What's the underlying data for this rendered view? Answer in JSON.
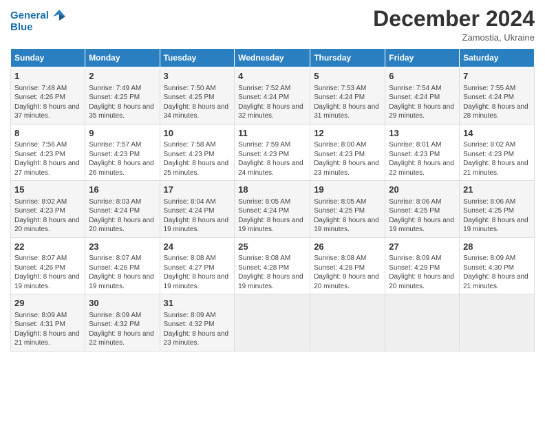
{
  "header": {
    "logo_line1": "General",
    "logo_line2": "Blue",
    "month_title": "December 2024",
    "location": "Zamostia, Ukraine"
  },
  "weekdays": [
    "Sunday",
    "Monday",
    "Tuesday",
    "Wednesday",
    "Thursday",
    "Friday",
    "Saturday"
  ],
  "weeks": [
    [
      {
        "day": "1",
        "info": "Sunrise: 7:48 AM\nSunset: 4:26 PM\nDaylight: 8 hours and 37 minutes."
      },
      {
        "day": "2",
        "info": "Sunrise: 7:49 AM\nSunset: 4:25 PM\nDaylight: 8 hours and 35 minutes."
      },
      {
        "day": "3",
        "info": "Sunrise: 7:50 AM\nSunset: 4:25 PM\nDaylight: 8 hours and 34 minutes."
      },
      {
        "day": "4",
        "info": "Sunrise: 7:52 AM\nSunset: 4:24 PM\nDaylight: 8 hours and 32 minutes."
      },
      {
        "day": "5",
        "info": "Sunrise: 7:53 AM\nSunset: 4:24 PM\nDaylight: 8 hours and 31 minutes."
      },
      {
        "day": "6",
        "info": "Sunrise: 7:54 AM\nSunset: 4:24 PM\nDaylight: 8 hours and 29 minutes."
      },
      {
        "day": "7",
        "info": "Sunrise: 7:55 AM\nSunset: 4:24 PM\nDaylight: 8 hours and 28 minutes."
      }
    ],
    [
      {
        "day": "8",
        "info": "Sunrise: 7:56 AM\nSunset: 4:23 PM\nDaylight: 8 hours and 27 minutes."
      },
      {
        "day": "9",
        "info": "Sunrise: 7:57 AM\nSunset: 4:23 PM\nDaylight: 8 hours and 26 minutes."
      },
      {
        "day": "10",
        "info": "Sunrise: 7:58 AM\nSunset: 4:23 PM\nDaylight: 8 hours and 25 minutes."
      },
      {
        "day": "11",
        "info": "Sunrise: 7:59 AM\nSunset: 4:23 PM\nDaylight: 8 hours and 24 minutes."
      },
      {
        "day": "12",
        "info": "Sunrise: 8:00 AM\nSunset: 4:23 PM\nDaylight: 8 hours and 23 minutes."
      },
      {
        "day": "13",
        "info": "Sunrise: 8:01 AM\nSunset: 4:23 PM\nDaylight: 8 hours and 22 minutes."
      },
      {
        "day": "14",
        "info": "Sunrise: 8:02 AM\nSunset: 4:23 PM\nDaylight: 8 hours and 21 minutes."
      }
    ],
    [
      {
        "day": "15",
        "info": "Sunrise: 8:02 AM\nSunset: 4:23 PM\nDaylight: 8 hours and 20 minutes."
      },
      {
        "day": "16",
        "info": "Sunrise: 8:03 AM\nSunset: 4:24 PM\nDaylight: 8 hours and 20 minutes."
      },
      {
        "day": "17",
        "info": "Sunrise: 8:04 AM\nSunset: 4:24 PM\nDaylight: 8 hours and 19 minutes."
      },
      {
        "day": "18",
        "info": "Sunrise: 8:05 AM\nSunset: 4:24 PM\nDaylight: 8 hours and 19 minutes."
      },
      {
        "day": "19",
        "info": "Sunrise: 8:05 AM\nSunset: 4:25 PM\nDaylight: 8 hours and 19 minutes."
      },
      {
        "day": "20",
        "info": "Sunrise: 8:06 AM\nSunset: 4:25 PM\nDaylight: 8 hours and 19 minutes."
      },
      {
        "day": "21",
        "info": "Sunrise: 8:06 AM\nSunset: 4:25 PM\nDaylight: 8 hours and 19 minutes."
      }
    ],
    [
      {
        "day": "22",
        "info": "Sunrise: 8:07 AM\nSunset: 4:26 PM\nDaylight: 8 hours and 19 minutes."
      },
      {
        "day": "23",
        "info": "Sunrise: 8:07 AM\nSunset: 4:26 PM\nDaylight: 8 hours and 19 minutes."
      },
      {
        "day": "24",
        "info": "Sunrise: 8:08 AM\nSunset: 4:27 PM\nDaylight: 8 hours and 19 minutes."
      },
      {
        "day": "25",
        "info": "Sunrise: 8:08 AM\nSunset: 4:28 PM\nDaylight: 8 hours and 19 minutes."
      },
      {
        "day": "26",
        "info": "Sunrise: 8:08 AM\nSunset: 4:28 PM\nDaylight: 8 hours and 20 minutes."
      },
      {
        "day": "27",
        "info": "Sunrise: 8:09 AM\nSunset: 4:29 PM\nDaylight: 8 hours and 20 minutes."
      },
      {
        "day": "28",
        "info": "Sunrise: 8:09 AM\nSunset: 4:30 PM\nDaylight: 8 hours and 21 minutes."
      }
    ],
    [
      {
        "day": "29",
        "info": "Sunrise: 8:09 AM\nSunset: 4:31 PM\nDaylight: 8 hours and 21 minutes."
      },
      {
        "day": "30",
        "info": "Sunrise: 8:09 AM\nSunset: 4:32 PM\nDaylight: 8 hours and 22 minutes."
      },
      {
        "day": "31",
        "info": "Sunrise: 8:09 AM\nSunset: 4:32 PM\nDaylight: 8 hours and 23 minutes."
      },
      null,
      null,
      null,
      null
    ]
  ]
}
